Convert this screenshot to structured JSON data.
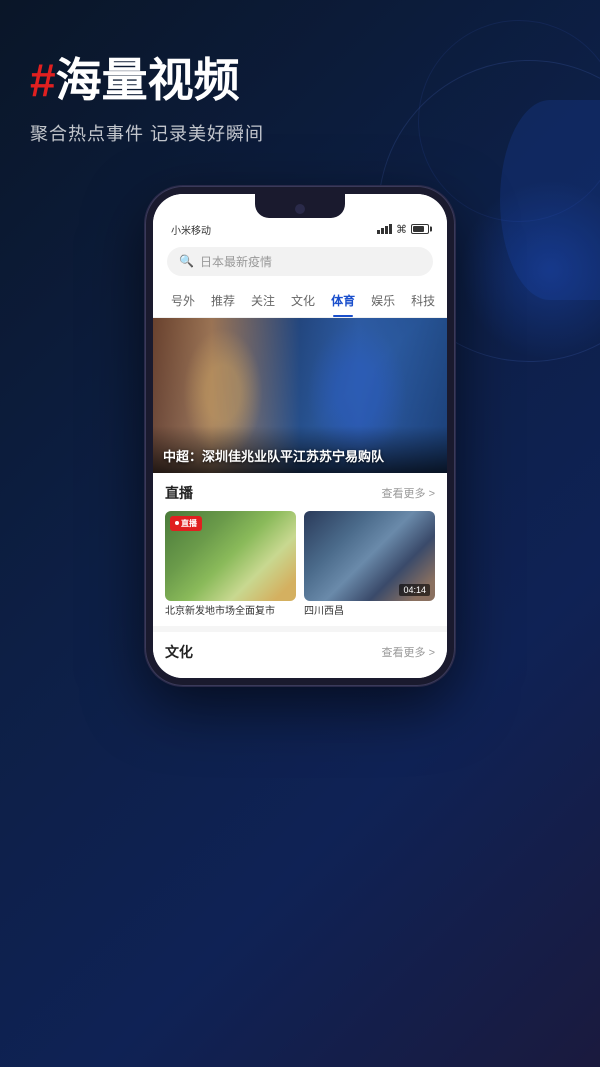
{
  "app": {
    "background_title_hash": "#",
    "main_title": "海量视频",
    "subtitle": "聚合热点事件 记录美好瞬间"
  },
  "status_bar": {
    "carrier": "小米移动",
    "time": ""
  },
  "search": {
    "placeholder": "日本最新疫情"
  },
  "nav_tabs": [
    {
      "label": "号外",
      "active": false
    },
    {
      "label": "推荐",
      "active": false
    },
    {
      "label": "关注",
      "active": false
    },
    {
      "label": "文化",
      "active": false
    },
    {
      "label": "体育",
      "active": true
    },
    {
      "label": "娱乐",
      "active": false
    },
    {
      "label": "科技",
      "active": false
    }
  ],
  "hero": {
    "title": "中超：深圳佳兆业队平江苏苏宁易购队"
  },
  "live_section": {
    "title": "直播",
    "more_label": "查看更多 >",
    "items": [
      {
        "badge": "直播",
        "caption": "北京新发地市场全面复市"
      },
      {
        "time": "04:14",
        "caption": "四川西昌"
      }
    ]
  },
  "culture_section": {
    "title": "文化",
    "more_label": "查看更多 >"
  }
}
